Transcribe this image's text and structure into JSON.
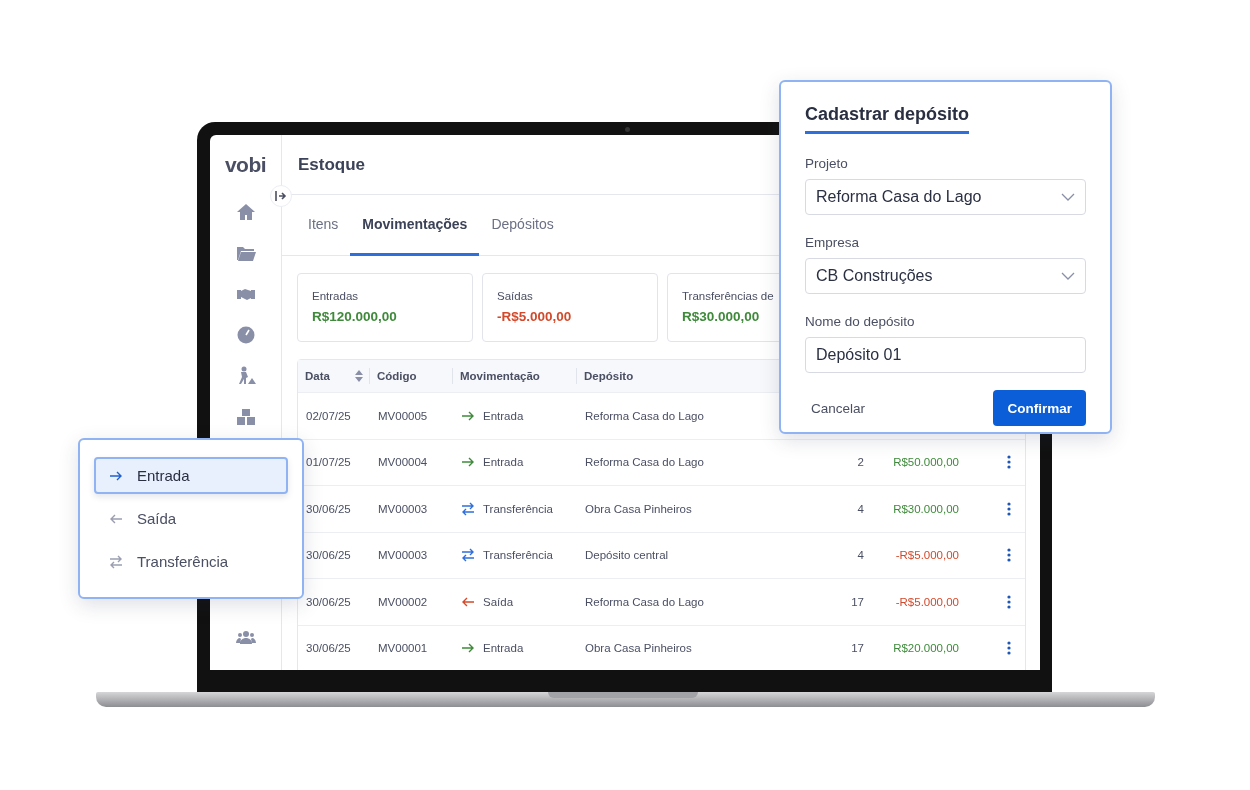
{
  "app": {
    "logo": "vobi",
    "page_title": "Estoque"
  },
  "tabs": [
    {
      "label": "Itens",
      "selected": false
    },
    {
      "label": "Movimentações",
      "selected": true
    },
    {
      "label": "Depósitos",
      "selected": false
    }
  ],
  "summary_cards": [
    {
      "label": "Entradas",
      "value": "R$120.000,00",
      "kind": "positive"
    },
    {
      "label": "Saídas",
      "value": "-R$5.000,00",
      "kind": "negative"
    },
    {
      "label": "Transferências de",
      "value": "R$30.000,00",
      "kind": "positive"
    }
  ],
  "table": {
    "columns": [
      "Data",
      "Código",
      "Movimentação",
      "Depósito"
    ],
    "rows": [
      {
        "date": "02/07/25",
        "code": "MV00005",
        "movement": {
          "kind": "in",
          "label": "Entrada"
        },
        "deposit": "Reforma Casa do Lago"
      },
      {
        "date": "01/07/25",
        "code": "MV00004",
        "movement": {
          "kind": "in",
          "label": "Entrada"
        },
        "deposit": "Reforma Casa do Lago",
        "quantity": "2",
        "value": {
          "text": "R$50.000,00",
          "kind": "positive"
        }
      },
      {
        "date": "30/06/25",
        "code": "MV00003",
        "movement": {
          "kind": "transfer",
          "label": "Transferência"
        },
        "deposit": "Obra Casa Pinheiros",
        "quantity": "4",
        "value": {
          "text": "R$30.000,00",
          "kind": "positive"
        }
      },
      {
        "date": "30/06/25",
        "code": "MV00003",
        "movement": {
          "kind": "transfer",
          "label": "Transferência"
        },
        "deposit": "Depósito central",
        "quantity": "4",
        "value": {
          "text": "-R$5.000,00",
          "kind": "negative"
        }
      },
      {
        "date": "30/06/25",
        "code": "MV00002",
        "movement": {
          "kind": "out",
          "label": "Saída"
        },
        "deposit": "Reforma Casa do Lago",
        "quantity": "17",
        "value": {
          "text": "-R$5.000,00",
          "kind": "negative"
        }
      },
      {
        "date": "30/06/25",
        "code": "MV00001",
        "movement": {
          "kind": "in",
          "label": "Entrada"
        },
        "deposit": "Obra Casa Pinheiros",
        "quantity": "17",
        "value": {
          "text": "R$20.000,00",
          "kind": "positive"
        }
      }
    ]
  },
  "dialog": {
    "title": "Cadastrar depósito",
    "fields": [
      {
        "label": "Projeto",
        "value": "Reforma Casa do Lago",
        "kind": "select"
      },
      {
        "label": "Empresa",
        "value": "CB Construções",
        "kind": "select"
      },
      {
        "label": "Nome do depósito",
        "value": "Depósito 01",
        "kind": "text"
      }
    ],
    "cancel": "Cancelar",
    "confirm": "Confirmar"
  },
  "type_menu": {
    "items": [
      {
        "label": "Entrada",
        "kind": "in",
        "selected": true
      },
      {
        "label": "Saída",
        "kind": "out",
        "selected": false
      },
      {
        "label": "Transferência",
        "kind": "transfer",
        "selected": false
      }
    ]
  }
}
